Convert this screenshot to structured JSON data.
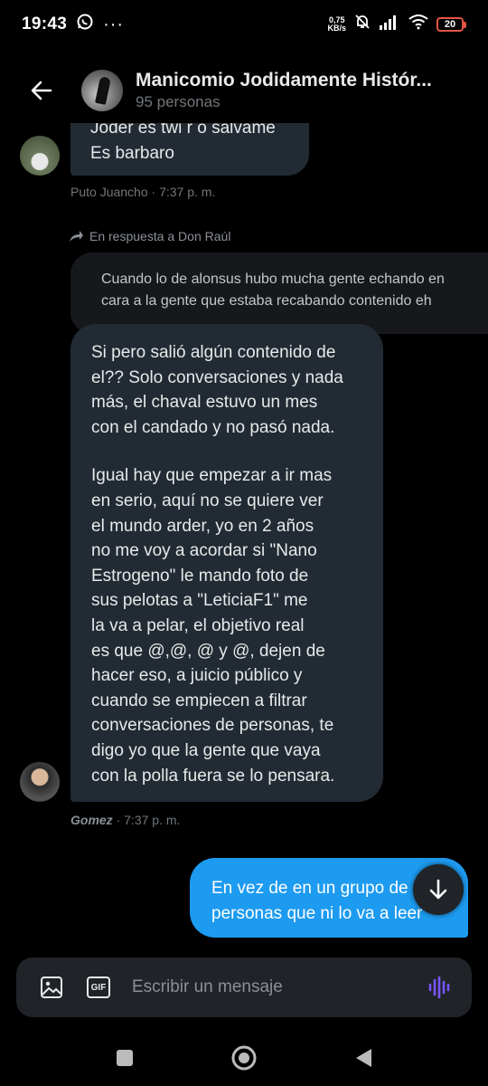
{
  "status_bar": {
    "time": "19:43",
    "dots": "···",
    "speed_value": "0,75",
    "speed_unit": "KB/s",
    "battery": "20"
  },
  "header": {
    "title": "Manicomio Jodidamente Histór...",
    "members": "95 personas"
  },
  "messages": {
    "first": {
      "cut_line": "Joder es twi r o salvame",
      "text": "Es barbaro",
      "author": "Puto Juancho",
      "time": "7:37 p. m."
    },
    "reply": {
      "reference": "En respuesta a Don Raúl",
      "quoted_line1": "Cuando lo de alonsus hubo mucha gente echando en",
      "quoted_line2": "cara a la gente que estaba recabando contenido eh",
      "lines_p1": [
        "Si pero salió algún contenido de",
        "el?? Solo conversaciones y nada",
        "más, el chaval estuvo un mes",
        "con el candado y no pasó nada."
      ],
      "lines_p2": [
        "Igual hay que empezar a ir mas",
        "en serio, aquí no se quiere ver",
        "el mundo arder, yo en 2 años",
        "no me voy a acordar si \"Nano",
        "Estrogeno\" le mando foto de",
        "sus pelotas a \"LeticiaF1\" me",
        "la va a pelar, el objetivo real",
        "es que @,@, @ y @, dejen de",
        "hacer eso, a juicio público y",
        "cuando se empiecen a filtrar",
        "conversaciones de personas, te",
        "digo yo que la gente que vaya",
        "con la polla fuera se lo pensara."
      ],
      "author": "Gomez",
      "time": "7:37 p. m."
    },
    "own": {
      "line1": "En vez de en un grupo de",
      "line2": "personas que ni lo va a leer"
    }
  },
  "composer": {
    "placeholder": "Escribir un mensaje",
    "gif_label": "GIF"
  },
  "colors": {
    "accent": "#1d9bf0",
    "bubble_incoming": "#222b33",
    "voice": "#7856ff"
  }
}
